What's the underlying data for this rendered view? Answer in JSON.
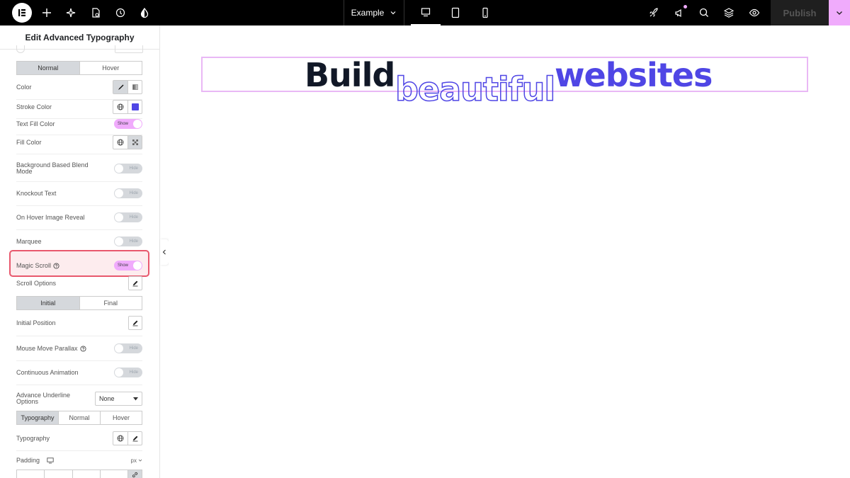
{
  "topbar": {
    "page_name": "Example",
    "publish_label": "Publish",
    "icons": [
      "elementor-logo-icon",
      "add-icon",
      "ai-sparkle-icon",
      "page-settings-icon",
      "history-icon",
      "theme-style-icon",
      "rocket-icon",
      "announcements-icon",
      "search-icon",
      "layers-icon",
      "preview-eye-icon",
      "chevron-down-icon"
    ],
    "accent": "#f0abfc"
  },
  "panel": {
    "title": "Edit Advanced Typography",
    "tabs1": [
      "Normal",
      "Hover"
    ],
    "color_label": "Color",
    "stroke_label": "Stroke Color",
    "text_fill_label": "Text Fill Color",
    "text_fill_toggle": "Show",
    "fill_color_label": "Fill Color",
    "blend_label_1": "Background Based Blend",
    "blend_label_2": "Mode",
    "blend_toggle": "Hide",
    "knockout_label": "Knockout Text",
    "knockout_toggle": "Hide",
    "hover_reveal_label": "On Hover Image Reveal",
    "hover_reveal_toggle": "Hide",
    "marquee_label": "Marquee",
    "marquee_toggle": "Hide",
    "magic_scroll_label": "Magic Scroll",
    "magic_scroll_toggle": "Show",
    "scroll_options_label": "Scroll Options",
    "tabs2": [
      "Initial",
      "Final"
    ],
    "initial_position_label": "Initial Position",
    "parallax_label": "Mouse Move Parallax",
    "parallax_toggle": "Hide",
    "continuous_label": "Continuous Animation",
    "continuous_toggle": "Hide",
    "underline_label_1": "Advance Underline",
    "underline_label_2": "Options",
    "underline_value": "None",
    "tabs3": [
      "Typography",
      "Normal",
      "Hover"
    ],
    "typography_label": "Typography",
    "padding_label": "Padding",
    "padding_unit": "px",
    "stroke_swatch": "#4f46e5",
    "highlight_color": "#e8586d"
  },
  "canvas": {
    "word1": "Build",
    "word2": "beautiful",
    "word3": "websites",
    "dark_color": "#111827",
    "accent_color": "#4f46e5"
  }
}
